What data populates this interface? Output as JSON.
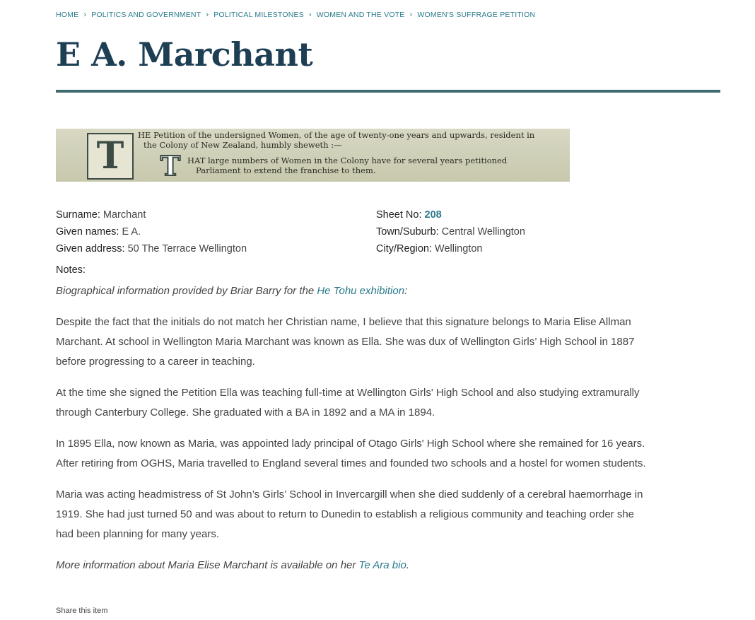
{
  "breadcrumb": [
    "HOME",
    "POLITICS AND GOVERNMENT",
    "POLITICAL MILESTONES",
    "WOMEN AND THE VOTE",
    "WOMEN'S SUFFRAGE PETITION"
  ],
  "title": "E A. Marchant",
  "petition_image": {
    "initial_1": "T",
    "line_1": "HE Petition of the undersigned Women, of the age of twenty-one years and upwards, resident in",
    "line_2": "the Colony of New Zealand, humbly sheweth :—",
    "initial_2": "T",
    "line_3": "HAT large numbers of Women in the Colony have for several years petitioned",
    "line_4": "Parliament to extend the franchise to them."
  },
  "details": {
    "surname_label": "Surname:",
    "surname": "Marchant",
    "given_names_label": "Given names:",
    "given_names": "E A.",
    "address_label": "Given address:",
    "address": "50 The Terrace Wellington",
    "sheet_label": "Sheet No:",
    "sheet": "208",
    "town_label": "Town/Suburb:",
    "town": "Central Wellington",
    "city_label": "City/Region:",
    "city": "Wellington"
  },
  "notes": {
    "label": "Notes:",
    "intro_text": "Biographical information provided by Briar Barry for the ",
    "intro_link": "He Tohu exhibition",
    "intro_end": ":",
    "paragraphs": [
      "Despite the fact that the initials do not match her Christian name, I believe that this signature belongs to Maria Elise Allman Marchant. At school in Wellington Maria Marchant was known as Ella. She was dux of Wellington Girls’ High School in 1887 before progressing to a career in teaching.",
      "At the time she signed the Petition Ella was teaching full-time at Wellington Girls' High School and also studying extramurally through Canterbury College. She graduated with a BA in 1892 and a MA in 1894.",
      "In 1895 Ella, now known as Maria, was appointed lady principal of Otago Girls' High School where she remained for 16 years. After retiring from OGHS, Maria travelled to England several times and founded two schools and a hostel for women students.",
      "Maria was acting headmistress of St John’s Girls’ School in Invercargill when she died suddenly of a cerebral haemorrhage in 1919. She had just turned 50 and was about to return to Dunedin to establish a religious community and teaching order she had been planning for many years."
    ],
    "more_text": "More information about Maria Elise Marchant is available on her ",
    "more_link": "Te Ara bio",
    "more_end": "."
  },
  "share_label": "Share this item",
  "colors": {
    "accent": "#2a7a8c",
    "title": "#1d3f54",
    "rule": "#3f6b6f"
  }
}
